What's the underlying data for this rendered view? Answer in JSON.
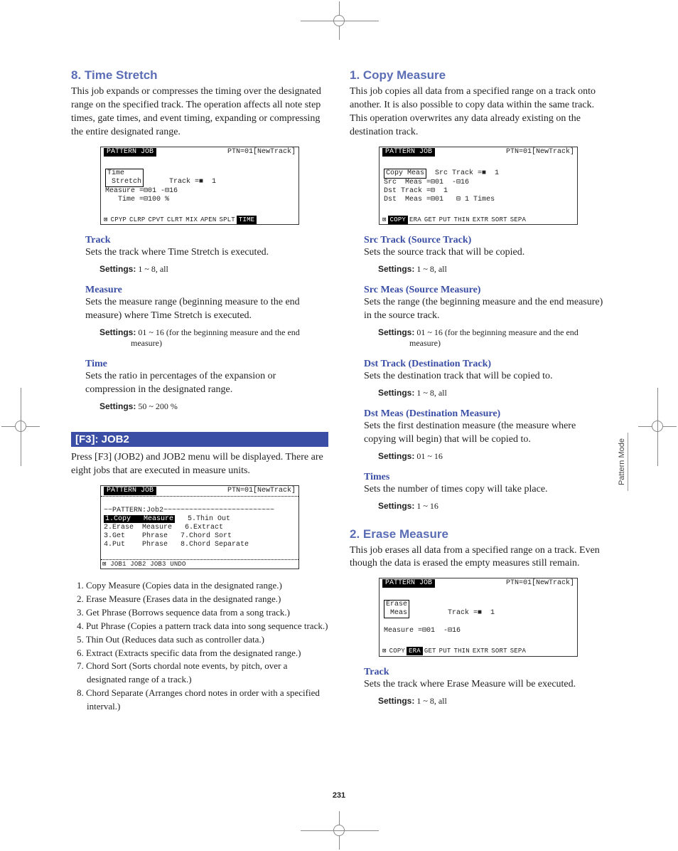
{
  "pageNumber": "231",
  "sideTab": "Pattern Mode",
  "left": {
    "sec8_title": "8. Time Stretch",
    "sec8_body": "This job expands or compresses the timing over the designated range on the specified track. The operation affects all note step times, gate times, and event timing, expanding or compressing the entire designated range.",
    "screen1": {
      "topLabel": "PATTERN JOB",
      "topRight": "PTN=01[NewTrack]",
      "box": "Time\n Stretch",
      "lines": "Track =■  1\nMeasure =⊟01 -⊟16\n   Time =⊟100 %",
      "tabs": [
        "CPYP",
        "CLRP",
        "CPVT",
        "CLRT",
        "MIX",
        "APEN",
        "SPLT",
        "TIME"
      ],
      "active": "TIME",
      "pre": "⊠"
    },
    "p_track_t": "Track",
    "p_track_d": "Sets the track where Time Stretch is executed.",
    "p_track_s": "1 ~ 8, all",
    "p_meas_t": "Measure",
    "p_meas_d": "Sets the measure range (beginning measure to the end measure) where Time Stretch is executed.",
    "p_meas_s": "01 ~ 16 (for the beginning measure and the end measure)",
    "p_time_t": "Time",
    "p_time_d": "Sets the ratio in percentages of the expansion or compression in the designated range.",
    "p_time_s": "50 ~ 200 %",
    "f3_title": "[F3]: JOB2",
    "f3_body": "Press [F3] (JOB2) and JOB2 menu will be displayed. There are eight jobs that are executed in measure units.",
    "screen2": {
      "topLabel": "PATTERN JOB",
      "topRight": "PTN=01[NewTrack]",
      "hdr": "~~PATTERN:Job2~~~~~~~~~~~~~~~~~~~~~~~~~~",
      "l1a": "1.Copy   Measure",
      "l1b": "5.Thin Out",
      "l2a": "2.Erase  Measure",
      "l2b": "6.Extract",
      "l3a": "3.Get    Phrase",
      "l3b": "7.Chord Sort",
      "l4a": "4.Put    Phrase",
      "l4b": "8.Chord Separate",
      "bot": "⊠     JOB1 JOB2 JOB3            UNDO"
    },
    "jobs": [
      "1. Copy Measure (Copies data in the designated range.)",
      "2. Erase Measure (Erases data in the designated range.)",
      "3. Get Phrase (Borrows sequence data from a song track.)",
      "4. Put Phrase (Copies a pattern track data into song sequence track.)",
      "5. Thin Out (Reduces data such as controller data.)",
      "6. Extract (Extracts specific data from the designated range.)",
      "7. Chord Sort (Sorts chordal note events, by pitch, over a designated range of a track.)",
      "8. Chord Separate (Arranges chord notes in order with a specified interval.)"
    ]
  },
  "right": {
    "sec1_title": "1. Copy Measure",
    "sec1_body": "This job copies all data from a specified range on a track onto another. It is also possible to copy data within the same track. This operation overwrites any data already existing on the destination track.",
    "screen3": {
      "topLabel": "PATTERN JOB",
      "topRight": "PTN=01[NewTrack]",
      "box": "Copy Meas",
      "lines": "Src Track =■  1\nSrc  Meas =⊟01  -⊟16\nDst Track =⊟  1\nDst  Meas =⊟01   ⊟ 1 Times",
      "tabs": [
        "COPY",
        "ERA",
        "GET",
        "PUT",
        "THIN",
        "EXTR",
        "SORT",
        "SEPA"
      ],
      "active": "COPY",
      "pre": "⊠"
    },
    "p_srct_t": "Src Track (Source Track)",
    "p_srct_d": "Sets the source track that will be copied.",
    "p_srct_s": "1 ~ 8, all",
    "p_srcm_t": "Src Meas (Source Measure)",
    "p_srcm_d": "Sets the range (the beginning measure and the end measure) in the source track.",
    "p_srcm_s": "01 ~ 16 (for the beginning measure and the end measure)",
    "p_dstt_t": "Dst Track (Destination Track)",
    "p_dstt_d": "Sets the destination track that will be copied to.",
    "p_dstt_s": "1 ~ 8, all",
    "p_dstm_t": "Dst Meas (Destination Measure)",
    "p_dstm_d": "Sets the first destination measure (the measure where copying will begin) that will be copied to.",
    "p_dstm_s": "01 ~ 16",
    "p_times_t": "Times",
    "p_times_d": "Sets the number of times copy will take place.",
    "p_times_s": "1 ~ 16",
    "sec2_title": "2. Erase Measure",
    "sec2_body": "This job erases all data from a specified range on a track. Even though the data is erased the empty measures still remain.",
    "screen4": {
      "topLabel": "PATTERN JOB",
      "topRight": "PTN=01[NewTrack]",
      "box": "Erase\n Meas",
      "lines": "   Track =■  1\n\nMeasure =⊟01  -⊟16",
      "tabs": [
        "COPY",
        "ERA",
        "GET",
        "PUT",
        "THIN",
        "EXTR",
        "SORT",
        "SEPA"
      ],
      "active": "ERA",
      "pre": "⊠"
    },
    "p_etrk_t": "Track",
    "p_etrk_d": "Sets the track where Erase Measure will be executed.",
    "p_etrk_s": "1 ~ 8, all"
  },
  "settingsLabel": "Settings:"
}
